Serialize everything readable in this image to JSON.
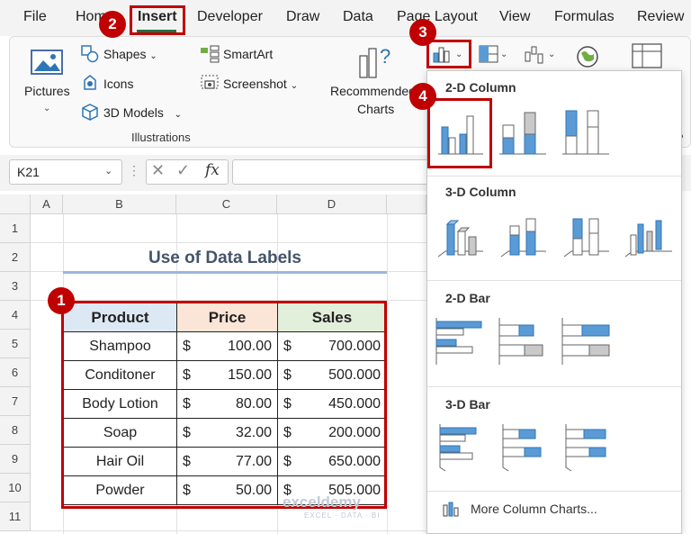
{
  "menu": {
    "tabs": [
      "File",
      "Home",
      "Insert",
      "Developer",
      "Draw",
      "Data",
      "Page Layout",
      "View",
      "Formulas",
      "Review"
    ],
    "active": "Insert"
  },
  "ribbon": {
    "pictures_label": "Pictures",
    "shapes_label": "Shapes",
    "icons_label": "Icons",
    "models_label": "3D Models",
    "smartart_label": "SmartArt",
    "screenshot_label": "Screenshot",
    "illustrations_label": "Illustrations",
    "recommended_label_1": "Recommended",
    "recommended_label_2": "Charts"
  },
  "formula_bar": {
    "name_box": "K21",
    "fx": "fx",
    "formula": ""
  },
  "sheet": {
    "columns": [
      "A",
      "B",
      "C",
      "D"
    ],
    "rows": [
      "1",
      "2",
      "3",
      "4",
      "5",
      "6",
      "7",
      "8",
      "9",
      "10",
      "11"
    ],
    "title": "Use of Data Labels",
    "headers": {
      "product": "Product",
      "price": "Price",
      "sales": "Sales"
    },
    "currency": "$",
    "records": [
      {
        "product": "Shampoo",
        "price": "100.00",
        "sales": "700.000"
      },
      {
        "product": "Conditoner",
        "price": "150.00",
        "sales": "500.000"
      },
      {
        "product": "Body Lotion",
        "price": "80.00",
        "sales": "450.000"
      },
      {
        "product": "Soap",
        "price": "32.00",
        "sales": "200.000"
      },
      {
        "product": "Hair Oil",
        "price": "77.00",
        "sales": "650.000"
      },
      {
        "product": "Powder",
        "price": "50.00",
        "sales": "505.000"
      }
    ]
  },
  "dropdown": {
    "section_2d_column": "2-D Column",
    "section_3d_column": "3-D Column",
    "section_2d_bar": "2-D Bar",
    "section_3d_bar": "3-D Bar",
    "more_charts": "More Column Charts...",
    "selected": "clustered-column"
  },
  "badges": [
    "1",
    "2",
    "3",
    "4"
  ],
  "watermark": {
    "name": "exceldemy",
    "tagline": "EXCEL · DATA · BI"
  },
  "colors": {
    "accent_red": "#c00000",
    "excel_green": "#1e7145",
    "chart_blue": "#5b9bd5",
    "title_color": "#44546a"
  }
}
